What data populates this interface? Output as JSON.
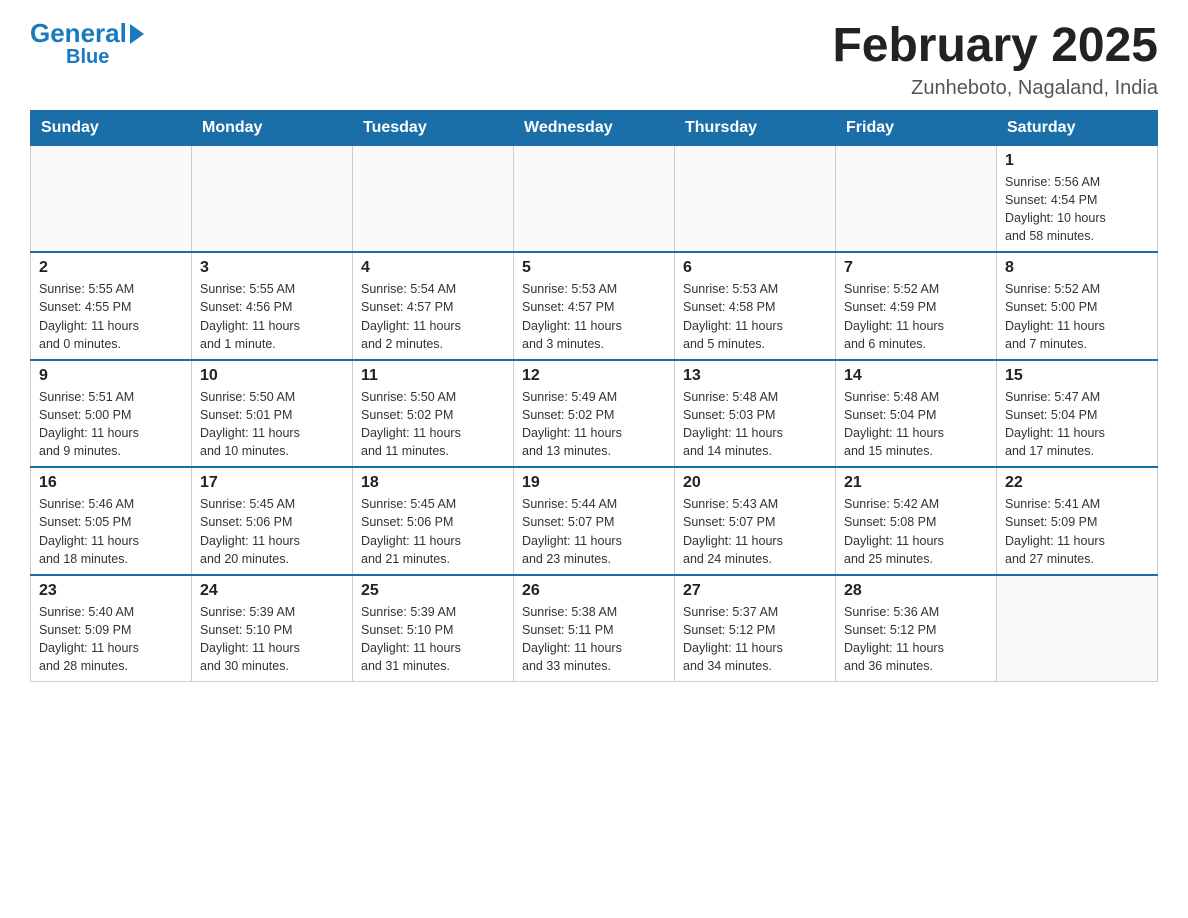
{
  "logo": {
    "general": "General",
    "triangle": "▶",
    "blue": "Blue"
  },
  "header": {
    "month_title": "February 2025",
    "location": "Zunheboto, Nagaland, India"
  },
  "weekdays": [
    "Sunday",
    "Monday",
    "Tuesday",
    "Wednesday",
    "Thursday",
    "Friday",
    "Saturday"
  ],
  "weeks": [
    [
      {
        "day": "",
        "info": ""
      },
      {
        "day": "",
        "info": ""
      },
      {
        "day": "",
        "info": ""
      },
      {
        "day": "",
        "info": ""
      },
      {
        "day": "",
        "info": ""
      },
      {
        "day": "",
        "info": ""
      },
      {
        "day": "1",
        "info": "Sunrise: 5:56 AM\nSunset: 4:54 PM\nDaylight: 10 hours\nand 58 minutes."
      }
    ],
    [
      {
        "day": "2",
        "info": "Sunrise: 5:55 AM\nSunset: 4:55 PM\nDaylight: 11 hours\nand 0 minutes."
      },
      {
        "day": "3",
        "info": "Sunrise: 5:55 AM\nSunset: 4:56 PM\nDaylight: 11 hours\nand 1 minute."
      },
      {
        "day": "4",
        "info": "Sunrise: 5:54 AM\nSunset: 4:57 PM\nDaylight: 11 hours\nand 2 minutes."
      },
      {
        "day": "5",
        "info": "Sunrise: 5:53 AM\nSunset: 4:57 PM\nDaylight: 11 hours\nand 3 minutes."
      },
      {
        "day": "6",
        "info": "Sunrise: 5:53 AM\nSunset: 4:58 PM\nDaylight: 11 hours\nand 5 minutes."
      },
      {
        "day": "7",
        "info": "Sunrise: 5:52 AM\nSunset: 4:59 PM\nDaylight: 11 hours\nand 6 minutes."
      },
      {
        "day": "8",
        "info": "Sunrise: 5:52 AM\nSunset: 5:00 PM\nDaylight: 11 hours\nand 7 minutes."
      }
    ],
    [
      {
        "day": "9",
        "info": "Sunrise: 5:51 AM\nSunset: 5:00 PM\nDaylight: 11 hours\nand 9 minutes."
      },
      {
        "day": "10",
        "info": "Sunrise: 5:50 AM\nSunset: 5:01 PM\nDaylight: 11 hours\nand 10 minutes."
      },
      {
        "day": "11",
        "info": "Sunrise: 5:50 AM\nSunset: 5:02 PM\nDaylight: 11 hours\nand 11 minutes."
      },
      {
        "day": "12",
        "info": "Sunrise: 5:49 AM\nSunset: 5:02 PM\nDaylight: 11 hours\nand 13 minutes."
      },
      {
        "day": "13",
        "info": "Sunrise: 5:48 AM\nSunset: 5:03 PM\nDaylight: 11 hours\nand 14 minutes."
      },
      {
        "day": "14",
        "info": "Sunrise: 5:48 AM\nSunset: 5:04 PM\nDaylight: 11 hours\nand 15 minutes."
      },
      {
        "day": "15",
        "info": "Sunrise: 5:47 AM\nSunset: 5:04 PM\nDaylight: 11 hours\nand 17 minutes."
      }
    ],
    [
      {
        "day": "16",
        "info": "Sunrise: 5:46 AM\nSunset: 5:05 PM\nDaylight: 11 hours\nand 18 minutes."
      },
      {
        "day": "17",
        "info": "Sunrise: 5:45 AM\nSunset: 5:06 PM\nDaylight: 11 hours\nand 20 minutes."
      },
      {
        "day": "18",
        "info": "Sunrise: 5:45 AM\nSunset: 5:06 PM\nDaylight: 11 hours\nand 21 minutes."
      },
      {
        "day": "19",
        "info": "Sunrise: 5:44 AM\nSunset: 5:07 PM\nDaylight: 11 hours\nand 23 minutes."
      },
      {
        "day": "20",
        "info": "Sunrise: 5:43 AM\nSunset: 5:07 PM\nDaylight: 11 hours\nand 24 minutes."
      },
      {
        "day": "21",
        "info": "Sunrise: 5:42 AM\nSunset: 5:08 PM\nDaylight: 11 hours\nand 25 minutes."
      },
      {
        "day": "22",
        "info": "Sunrise: 5:41 AM\nSunset: 5:09 PM\nDaylight: 11 hours\nand 27 minutes."
      }
    ],
    [
      {
        "day": "23",
        "info": "Sunrise: 5:40 AM\nSunset: 5:09 PM\nDaylight: 11 hours\nand 28 minutes."
      },
      {
        "day": "24",
        "info": "Sunrise: 5:39 AM\nSunset: 5:10 PM\nDaylight: 11 hours\nand 30 minutes."
      },
      {
        "day": "25",
        "info": "Sunrise: 5:39 AM\nSunset: 5:10 PM\nDaylight: 11 hours\nand 31 minutes."
      },
      {
        "day": "26",
        "info": "Sunrise: 5:38 AM\nSunset: 5:11 PM\nDaylight: 11 hours\nand 33 minutes."
      },
      {
        "day": "27",
        "info": "Sunrise: 5:37 AM\nSunset: 5:12 PM\nDaylight: 11 hours\nand 34 minutes."
      },
      {
        "day": "28",
        "info": "Sunrise: 5:36 AM\nSunset: 5:12 PM\nDaylight: 11 hours\nand 36 minutes."
      },
      {
        "day": "",
        "info": ""
      }
    ]
  ]
}
